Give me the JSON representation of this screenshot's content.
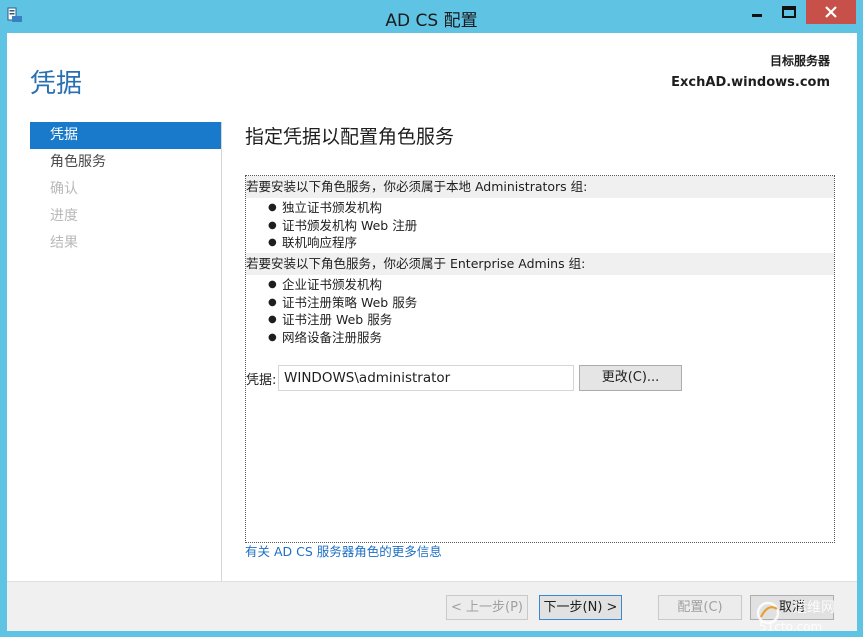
{
  "window": {
    "title": "AD CS 配置"
  },
  "header": {
    "title": "凭据",
    "target_label": "目标服务器",
    "target_name": "ExchAD.windows.com"
  },
  "nav": {
    "items": [
      {
        "label": "凭据",
        "state": "active"
      },
      {
        "label": "角色服务",
        "state": "enabled"
      },
      {
        "label": "确认",
        "state": "disabled"
      },
      {
        "label": "进度",
        "state": "disabled"
      },
      {
        "label": "结果",
        "state": "disabled"
      }
    ]
  },
  "main": {
    "heading": "指定凭据以配置角色服务",
    "section1": {
      "header": "若要安装以下角色服务，你必须属于本地 Administrators 组:",
      "items": [
        "独立证书颁发机构",
        "证书颁发机构 Web 注册",
        "联机响应程序"
      ]
    },
    "section2": {
      "header": "若要安装以下角色服务，你必须属于 Enterprise Admins 组:",
      "items": [
        "企业证书颁发机构",
        "证书注册策略 Web 服务",
        "证书注册 Web 服务",
        "网络设备注册服务"
      ]
    },
    "credentials": {
      "label": "凭据:",
      "value": "WINDOWS\\administrator",
      "change_button": "更改(C)..."
    },
    "more_link": "有关 AD CS 服务器角色的更多信息"
  },
  "footer": {
    "prev": "< 上一步(P)",
    "next": "下一步(N) >",
    "configure": "配置(C)",
    "cancel": "取消"
  },
  "watermark": {
    "line1": "运维网",
    "line2": "51cto.com"
  },
  "colors": {
    "titlebar": "#5fc3e4",
    "accent": "#1979ca",
    "header_title": "#2a6fb2",
    "link": "#1c6fc4",
    "close_button": "#c7504a"
  }
}
